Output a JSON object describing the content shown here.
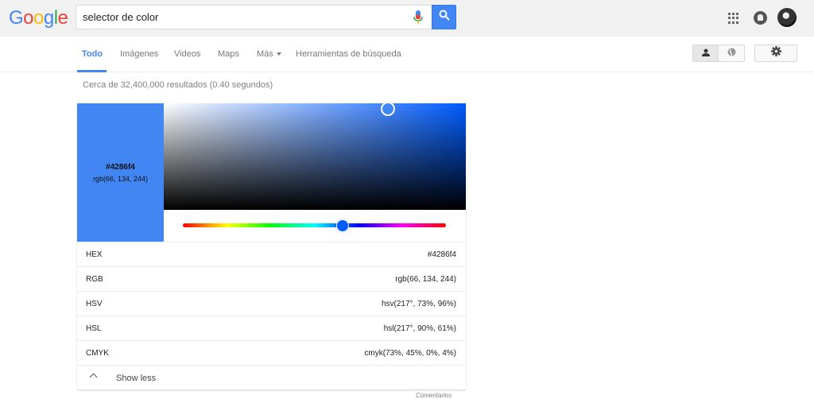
{
  "header": {
    "logo_letters": [
      {
        "char": "G",
        "color": "#4285f4"
      },
      {
        "char": "o",
        "color": "#ea4335"
      },
      {
        "char": "o",
        "color": "#fbbc05"
      },
      {
        "char": "g",
        "color": "#4285f4"
      },
      {
        "char": "l",
        "color": "#34a853"
      },
      {
        "char": "e",
        "color": "#ea4335"
      }
    ],
    "search_query": "selector de color",
    "icons": [
      "mic-icon",
      "search-icon",
      "apps-grid-icon",
      "notifications-icon",
      "avatar"
    ]
  },
  "tabs": [
    {
      "label": "Todo",
      "active": true
    },
    {
      "label": "Imágenes"
    },
    {
      "label": "Videos"
    },
    {
      "label": "Maps"
    },
    {
      "label": "Más"
    },
    {
      "label": "Herramientas de búsqueda"
    }
  ],
  "results_count": "Cerca de 32,400,000 resultados (0.40 segundos)",
  "color_picker": {
    "hex": "#4286f4",
    "rgb": "rgb(66, 134, 244)",
    "hue_color": "#005cff",
    "rows": [
      {
        "label": "HEX",
        "value": "#4286f4"
      },
      {
        "label": "RGB",
        "value": "rgb(66, 134, 244)"
      },
      {
        "label": "HSV",
        "value": "hsv(217°, 73%, 96%)"
      },
      {
        "label": "HSL",
        "value": "hsl(217°, 90%, 61%)"
      },
      {
        "label": "CMYK",
        "value": "cmyk(73%, 45%, 0%, 4%)"
      }
    ],
    "show_less": "Show less",
    "feedback": "Comentarios"
  }
}
